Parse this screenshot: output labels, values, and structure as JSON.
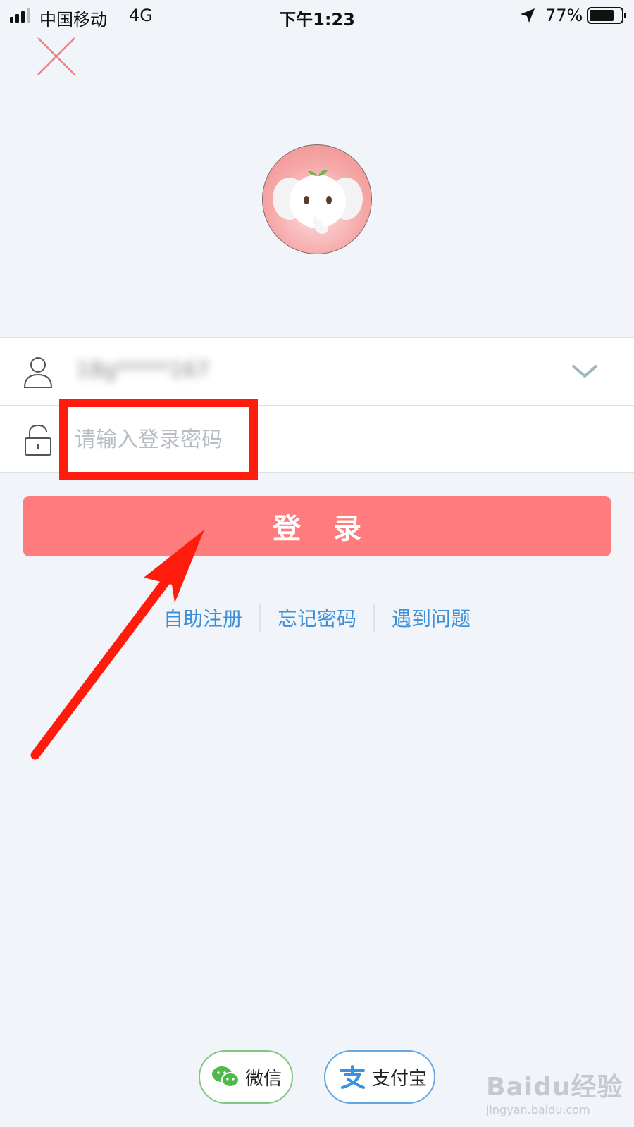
{
  "status_bar": {
    "carrier": "中国移动",
    "network": "4G",
    "time": "下午1:23",
    "battery_percent": "77%",
    "battery_level": 0.77,
    "location_icon": "location-arrow-icon"
  },
  "header": {
    "close_icon": "close-icon"
  },
  "avatar": {
    "icon": "elephant-mascot-icon"
  },
  "form": {
    "username_icon": "user-icon",
    "username_value": "18g*****167",
    "dropdown_icon": "chevron-down-icon",
    "password_icon": "lock-icon",
    "password_placeholder": "请输入登录密码"
  },
  "login_button": {
    "label": "登 录"
  },
  "links": [
    {
      "label": "自助注册"
    },
    {
      "label": "忘记密码"
    },
    {
      "label": "遇到问题"
    }
  ],
  "social_login": [
    {
      "label": "微信",
      "icon": "wechat-icon"
    },
    {
      "label": "支付宝",
      "icon": "alipay-icon"
    }
  ],
  "annotation": {
    "color": "#ff1c0d"
  },
  "watermark": {
    "main": "Baidu经验",
    "sub": "jingyan.baidu.com"
  },
  "colors": {
    "background": "#f1f4f8",
    "primary_button": "#ff7c7e",
    "link": "#3c8fd8",
    "close_icon": "#f08080"
  }
}
